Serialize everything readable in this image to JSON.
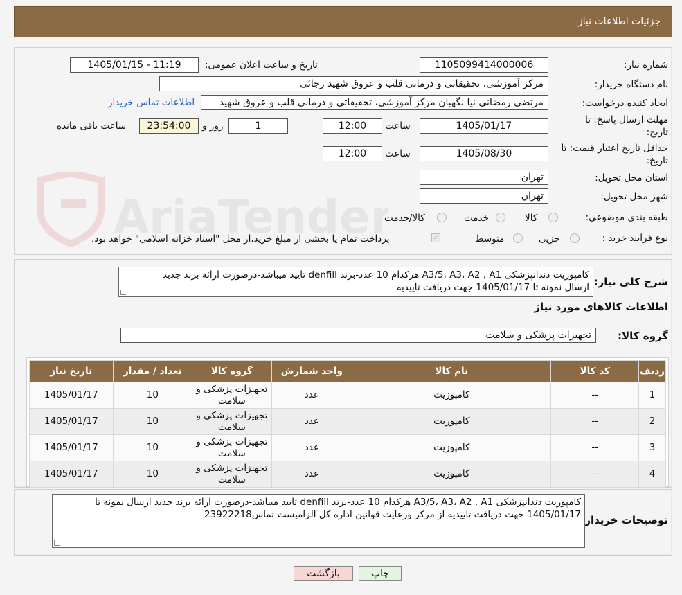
{
  "header": {
    "title": "جزئیات اطلاعات نیاز"
  },
  "form": {
    "need_number_label": "شماره نیاز:",
    "need_number": "1105099414000006",
    "announce_label": "تاریخ و ساعت اعلان عمومی:",
    "announce_value": "1405/01/15 - 11:19",
    "buyer_org_label": "نام دستگاه خریدار:",
    "buyer_org": "مرکز آموزشی، تحقیقاتی و درمانی قلب و عروق شهید رجائی",
    "creator_label": "ایجاد کننده درخواست:",
    "creator": "مرتضی رمضانی نیا نگهبان مرکز آموزشی، تحقیقاتی و درمانی قلب و عروق شهید",
    "buyer_contact_link": "اطلاعات تماس خریدار",
    "reply_deadline_label": "مهلت ارسال پاسخ: تا تاریخ:",
    "reply_date": "1405/01/17",
    "time_label": "ساعت",
    "reply_time": "12:00",
    "days_value": "1",
    "days_label": "روز و",
    "remaining_time": "23:54:00",
    "remaining_label": "ساعت باقی مانده",
    "price_validity_label": "حداقل تاریخ اعتبار قیمت: تا تاریخ:",
    "validity_date": "1405/08/30",
    "validity_time": "12:00",
    "province_label": "استان محل تحویل:",
    "province": "تهران",
    "city_label": "شهر محل تحویل:",
    "city": "تهران",
    "category_label": "طبقه بندی موضوعی:",
    "category_options": [
      "کالا",
      "خدمت",
      "کالا/خدمت"
    ],
    "process_label": "نوع فرآیند خرید :",
    "process_options": [
      "جزیی",
      "متوسط"
    ],
    "payment_note": "پرداخت تمام یا بخشی از مبلغ خرید،از محل \"اسناد خزانه اسلامی\" خواهد بود."
  },
  "details": {
    "summary_label": "شرح کلی نیاز:",
    "summary_line1": "کامپوزیت دندانپزشکی A3/5، A3، A2 , A1  هرکدام 10 عدد-برند  denfill تایید میباشد-درصورت ارائه برند جدید",
    "summary_line2": "ارسال نمونه  تا 1405/01/17 جهت دریافت تاییدیه",
    "goods_info_title": "اطلاعات کالاهای مورد نیاز",
    "goods_group_label": "گروه کالا:",
    "goods_group": "تجهیزات پزشکی و سلامت"
  },
  "table": {
    "headers": [
      "ردیف",
      "کد کالا",
      "نام کالا",
      "واحد شمارش",
      "گروه کالا",
      "تعداد / مقدار",
      "تاریخ نیاز"
    ],
    "rows": [
      [
        "1",
        "--",
        "کامپوزیت",
        "عدد",
        "تجهیزات پزشکی و سلامت",
        "10",
        "1405/01/17"
      ],
      [
        "2",
        "--",
        "کامپوزیت",
        "عدد",
        "تجهیزات پزشکی و سلامت",
        "10",
        "1405/01/17"
      ],
      [
        "3",
        "--",
        "کامپوزیت",
        "عدد",
        "تجهیزات پزشکی و سلامت",
        "10",
        "1405/01/17"
      ],
      [
        "4",
        "--",
        "کامپوزیت",
        "عدد",
        "تجهیزات پزشکی و سلامت",
        "10",
        "1405/01/17"
      ]
    ]
  },
  "buyer_notes": {
    "label": "توضیحات خریدار:",
    "line1": "کامپوزیت دندانپزشکی A3/5، A3، A2 , A1  هرکدام 10 عدد-برند  denfill تایید میباشد-درصورت ارائه برند جدید ارسال نمونه  تا",
    "line2": "1405/01/17 جهت دریافت تاییدیه از مرکز ورعایت قوانین اداره کل الزامیست-تماس23922218"
  },
  "buttons": {
    "print": "چاپ",
    "back": "بازگشت"
  },
  "watermark": {
    "text": "AriaTender.neT"
  },
  "colors": {
    "header_brown": "#8b6b45",
    "link_blue": "#1d5fbf",
    "back_button_pink": "#f8d6d6",
    "print_button_green": "#e3f5e0"
  }
}
